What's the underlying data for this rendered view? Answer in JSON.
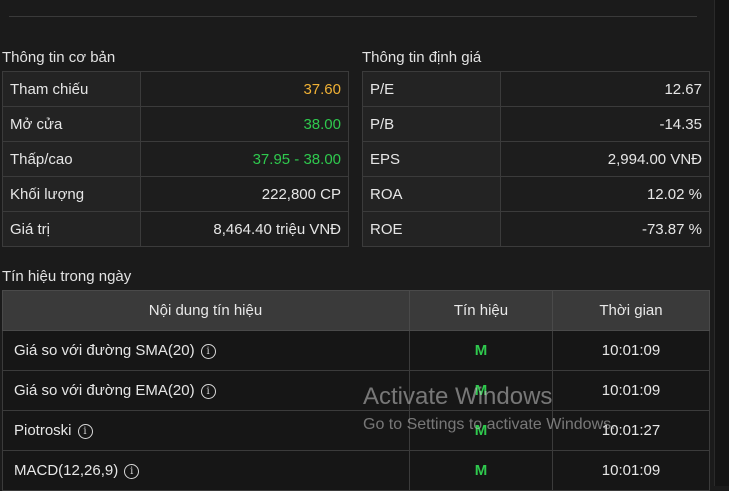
{
  "basic": {
    "title": "Thông tin cơ bản",
    "rows": [
      {
        "label": "Tham chiếu",
        "value": "37.60",
        "color": "#f0b135"
      },
      {
        "label": "Mở cửa",
        "value": "38.00",
        "color": "#2fc94e"
      },
      {
        "label": "Thấp/cao",
        "value": "37.95 - 38.00",
        "color": "#2fc94e"
      },
      {
        "label": "Khối lượng",
        "value": "222,800 CP"
      },
      {
        "label": "Giá trị",
        "value": "8,464.40 triệu VNĐ"
      }
    ]
  },
  "valuation": {
    "title": "Thông tin định giá",
    "rows": [
      {
        "label": "P/E",
        "value": "12.67"
      },
      {
        "label": "P/B",
        "value": "-14.35"
      },
      {
        "label": "EPS",
        "value": "2,994.00 VNĐ"
      },
      {
        "label": "ROA",
        "value": "12.02 %"
      },
      {
        "label": "ROE",
        "value": "-73.87 %"
      }
    ]
  },
  "signals": {
    "title": "Tín hiệu trong ngày",
    "headers": {
      "content": "Nội dung tín hiệu",
      "signal": "Tín hiệu",
      "time": "Thời gian"
    },
    "rows": [
      {
        "content": "Giá so với đường SMA(20)",
        "signal": "M",
        "time": "10:01:09"
      },
      {
        "content": "Giá so với đường EMA(20)",
        "signal": "M",
        "time": "10:01:09"
      },
      {
        "content": "Piotroski",
        "signal": "M",
        "time": "10:01:27"
      },
      {
        "content": "MACD(12,26,9)",
        "signal": "M",
        "time": "10:01:09"
      }
    ]
  },
  "watermark": {
    "title": "Activate Windows",
    "subtitle": "Go to Settings to activate Windows."
  }
}
